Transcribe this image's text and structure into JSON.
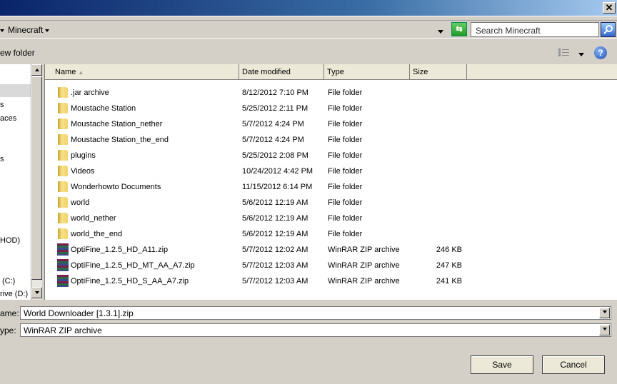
{
  "address": {
    "crumb": "Minecraft",
    "search_placeholder": "Search Minecraft"
  },
  "toolbar": {
    "new_folder": "ew folder"
  },
  "nav": {
    "items": [
      "s",
      "aces",
      "s",
      "HOD)",
      "(C:)",
      "rive (D:)"
    ]
  },
  "columns": [
    "Name",
    "Date modified",
    "Type",
    "Size"
  ],
  "files": [
    {
      "name": ".jar archive",
      "date": "8/12/2012 7:10 PM",
      "type": "File folder",
      "size": "",
      "icon": "folder"
    },
    {
      "name": "Moustache Station",
      "date": "5/25/2012 2:11 PM",
      "type": "File folder",
      "size": "",
      "icon": "folder"
    },
    {
      "name": "Moustache Station_nether",
      "date": "5/7/2012 4:24 PM",
      "type": "File folder",
      "size": "",
      "icon": "folder"
    },
    {
      "name": "Moustache Station_the_end",
      "date": "5/7/2012 4:24 PM",
      "type": "File folder",
      "size": "",
      "icon": "folder"
    },
    {
      "name": "plugins",
      "date": "5/25/2012 2:08 PM",
      "type": "File folder",
      "size": "",
      "icon": "folder"
    },
    {
      "name": "Videos",
      "date": "10/24/2012 4:42 PM",
      "type": "File folder",
      "size": "",
      "icon": "folder"
    },
    {
      "name": "Wonderhowto Documents",
      "date": "11/15/2012 6:14 PM",
      "type": "File folder",
      "size": "",
      "icon": "folder"
    },
    {
      "name": "world",
      "date": "5/6/2012 12:19 AM",
      "type": "File folder",
      "size": "",
      "icon": "folder"
    },
    {
      "name": "world_nether",
      "date": "5/6/2012 12:19 AM",
      "type": "File folder",
      "size": "",
      "icon": "folder"
    },
    {
      "name": "world_the_end",
      "date": "5/6/2012 12:19 AM",
      "type": "File folder",
      "size": "",
      "icon": "folder"
    },
    {
      "name": "OptiFine_1.2.5_HD_A11.zip",
      "date": "5/7/2012 12:02 AM",
      "type": "WinRAR ZIP archive",
      "size": "246 KB",
      "icon": "winrar"
    },
    {
      "name": "OptiFine_1.2.5_HD_MT_AA_A7.zip",
      "date": "5/7/2012 12:03 AM",
      "type": "WinRAR ZIP archive",
      "size": "247 KB",
      "icon": "winrar"
    },
    {
      "name": "OptiFine_1.2.5_HD_S_AA_A7.zip",
      "date": "5/7/2012 12:03 AM",
      "type": "WinRAR ZIP archive",
      "size": "241 KB",
      "icon": "winrar"
    }
  ],
  "form": {
    "filename_label": "ame:",
    "filename": "World Downloader [1.3.1].zip",
    "type_label": "ype:",
    "type": "WinRAR ZIP archive"
  },
  "buttons": {
    "save": "Save",
    "cancel": "Cancel"
  }
}
